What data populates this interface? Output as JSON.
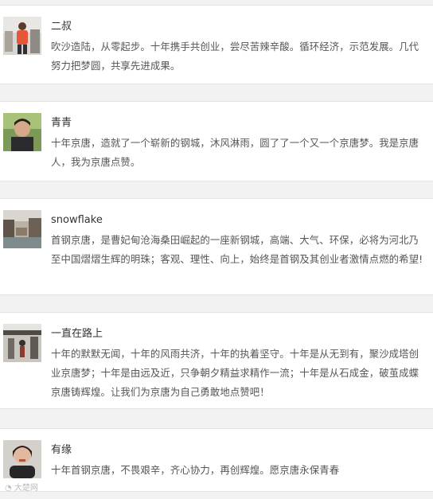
{
  "comments": [
    {
      "name": "二叔",
      "text": "吹沙造陆，从零起步。十年携手共创业，尝尽苦辣辛酸。循环经济，示范发展。几代努力把梦圆，共享先进成果。"
    },
    {
      "name": "青青",
      "text": "十年京唐，造就了一个崭新的钢城，沐风淋雨，圆了了一个又一个京唐梦。我是京唐人，我为京唐点赞。"
    },
    {
      "name": "snowflake",
      "text": "首钢京唐，是曹妃甸沧海桑田崛起的一座新钢城，高端、大气、环保，必将为河北乃至中国熠熠生辉的明珠；客观、理性、向上，始终是首钢及其创业者激情点燃的希望!"
    },
    {
      "name": "一直在路上",
      "text": "十年的默默无闻，十年的风雨共济，十年的执着坚守。十年是从无到有，聚沙成塔创业京唐梦；十年是由远及近，只争朝夕精益求精作一流；十年是从石成金，破茧成蝶京唐铸辉煌。让我们为京唐为自己勇敢地点赞吧！"
    },
    {
      "name": "有缘",
      "text": "十年首钢京唐，不畏艰辛，齐心协力，再创辉煌。愿京唐永保青春"
    }
  ],
  "watermark": "大楚网"
}
